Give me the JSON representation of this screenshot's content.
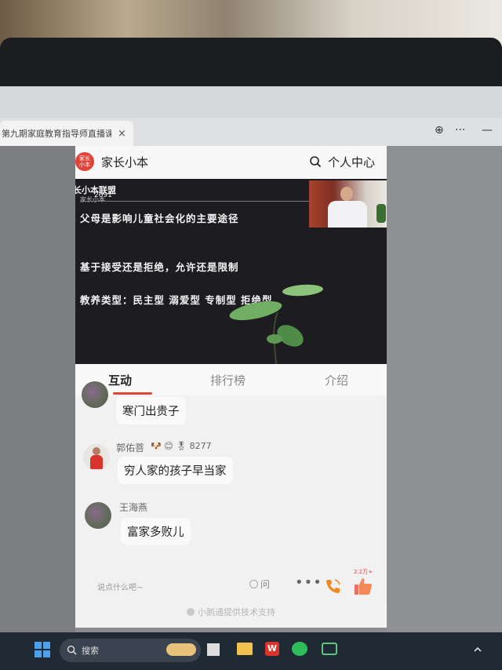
{
  "browser": {
    "tab_title": "第九期家庭教育指导师直播课",
    "tab_close": "×",
    "globe_label": "⊕",
    "menu_label": "···",
    "minimize_label": "—"
  },
  "app": {
    "logo_text_top": "家长",
    "logo_text_bottom": "小本",
    "name": "家长小本",
    "personal_center": "个人中心"
  },
  "video": {
    "brand": "家长小本联盟",
    "brand_sub": "家长小本",
    "count": "2691",
    "lines": [
      "父母是影响儿童社会化的主要途径",
      "基于接受还是拒绝，允许还是限制",
      "教养类型：民主型  溺爱型  专制型  拒绝型"
    ]
  },
  "tabs": [
    {
      "label": "互动",
      "active": true
    },
    {
      "label": "排行榜",
      "active": false
    },
    {
      "label": "介绍",
      "active": false
    }
  ],
  "messages": [
    {
      "user": "",
      "text": "寒门出贵子"
    },
    {
      "user": "郭佑菩",
      "badges": "🐶 😊 🎖 8277",
      "text": "穷人家的孩子早当家"
    },
    {
      "user": "王海燕",
      "text": "富家多败儿"
    }
  ],
  "input": {
    "placeholder": "说点什么吧~",
    "ask_label": "问",
    "more_label": "•••",
    "like_count": "2.2万+"
  },
  "support_text": "小鹅通提供技术支持",
  "taskbar": {
    "search_label": "搜索"
  },
  "colors": {
    "accent": "#e34239",
    "app_bg": "#f2f2f2",
    "video_bg": "#1d1d21"
  }
}
